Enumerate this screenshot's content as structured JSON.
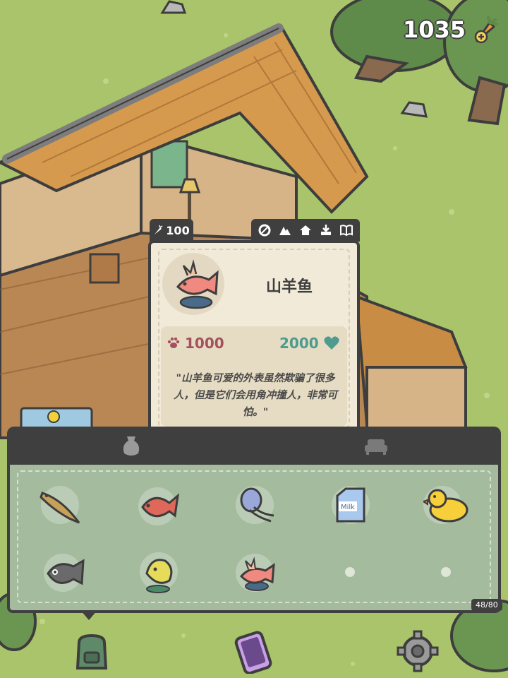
{
  "hud": {
    "currency_value": "1035",
    "currency_icon": "carrot-plus-icon"
  },
  "card": {
    "price": "100",
    "price_icon": "carrot-icon",
    "tab_icons": [
      "leaf-icon",
      "mountain-icon",
      "house-icon",
      "gift-icon",
      "book-icon"
    ],
    "item_name": "山羊鱼",
    "stat_left": "1000",
    "stat_left_icon": "paw-icon",
    "stat_right": "2000",
    "stat_right_icon": "heart-icon",
    "description": "\"山羊鱼可爱的外表虽然欺骗了很多人，但是它们会用角冲撞人，非常可怕。\""
  },
  "inventory": {
    "tabs": [
      "fish-bag-tab",
      "furniture-tab"
    ],
    "items": [
      "fish-1",
      "red-fish",
      "jellyfish",
      "milk-carton",
      "rubber-duck",
      "catfish",
      "yellow-fish",
      "goat-fish",
      "empty",
      "empty"
    ],
    "milk_label": "Milk",
    "counter": "48/80"
  },
  "bottom_bar": [
    "backpack-button",
    "phone-button",
    "settings-button"
  ],
  "colors": {
    "panel_dark": "#3f3f3f",
    "card_bg": "#f2ead8",
    "inventory_bg": "#a4bb9e",
    "grass": "#a9c46a",
    "red_stat": "#a3515e",
    "teal_stat": "#4f9b8e"
  }
}
